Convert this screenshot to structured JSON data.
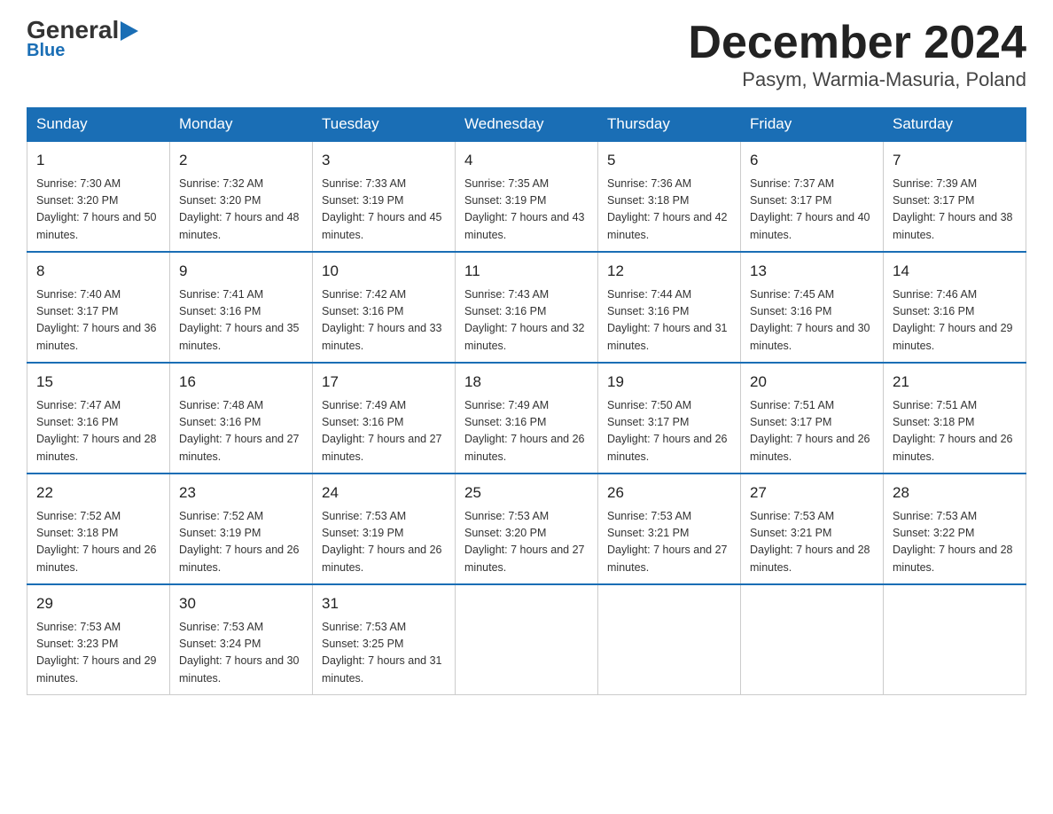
{
  "header": {
    "logo_main": "General",
    "logo_triangle": "▶",
    "logo_sub": "Blue",
    "title": "December 2024",
    "subtitle": "Pasym, Warmia-Masuria, Poland"
  },
  "weekdays": [
    "Sunday",
    "Monday",
    "Tuesday",
    "Wednesday",
    "Thursday",
    "Friday",
    "Saturday"
  ],
  "weeks": [
    [
      {
        "day": "1",
        "sunrise": "7:30 AM",
        "sunset": "3:20 PM",
        "daylight": "7 hours and 50 minutes."
      },
      {
        "day": "2",
        "sunrise": "7:32 AM",
        "sunset": "3:20 PM",
        "daylight": "7 hours and 48 minutes."
      },
      {
        "day": "3",
        "sunrise": "7:33 AM",
        "sunset": "3:19 PM",
        "daylight": "7 hours and 45 minutes."
      },
      {
        "day": "4",
        "sunrise": "7:35 AM",
        "sunset": "3:19 PM",
        "daylight": "7 hours and 43 minutes."
      },
      {
        "day": "5",
        "sunrise": "7:36 AM",
        "sunset": "3:18 PM",
        "daylight": "7 hours and 42 minutes."
      },
      {
        "day": "6",
        "sunrise": "7:37 AM",
        "sunset": "3:17 PM",
        "daylight": "7 hours and 40 minutes."
      },
      {
        "day": "7",
        "sunrise": "7:39 AM",
        "sunset": "3:17 PM",
        "daylight": "7 hours and 38 minutes."
      }
    ],
    [
      {
        "day": "8",
        "sunrise": "7:40 AM",
        "sunset": "3:17 PM",
        "daylight": "7 hours and 36 minutes."
      },
      {
        "day": "9",
        "sunrise": "7:41 AM",
        "sunset": "3:16 PM",
        "daylight": "7 hours and 35 minutes."
      },
      {
        "day": "10",
        "sunrise": "7:42 AM",
        "sunset": "3:16 PM",
        "daylight": "7 hours and 33 minutes."
      },
      {
        "day": "11",
        "sunrise": "7:43 AM",
        "sunset": "3:16 PM",
        "daylight": "7 hours and 32 minutes."
      },
      {
        "day": "12",
        "sunrise": "7:44 AM",
        "sunset": "3:16 PM",
        "daylight": "7 hours and 31 minutes."
      },
      {
        "day": "13",
        "sunrise": "7:45 AM",
        "sunset": "3:16 PM",
        "daylight": "7 hours and 30 minutes."
      },
      {
        "day": "14",
        "sunrise": "7:46 AM",
        "sunset": "3:16 PM",
        "daylight": "7 hours and 29 minutes."
      }
    ],
    [
      {
        "day": "15",
        "sunrise": "7:47 AM",
        "sunset": "3:16 PM",
        "daylight": "7 hours and 28 minutes."
      },
      {
        "day": "16",
        "sunrise": "7:48 AM",
        "sunset": "3:16 PM",
        "daylight": "7 hours and 27 minutes."
      },
      {
        "day": "17",
        "sunrise": "7:49 AM",
        "sunset": "3:16 PM",
        "daylight": "7 hours and 27 minutes."
      },
      {
        "day": "18",
        "sunrise": "7:49 AM",
        "sunset": "3:16 PM",
        "daylight": "7 hours and 26 minutes."
      },
      {
        "day": "19",
        "sunrise": "7:50 AM",
        "sunset": "3:17 PM",
        "daylight": "7 hours and 26 minutes."
      },
      {
        "day": "20",
        "sunrise": "7:51 AM",
        "sunset": "3:17 PM",
        "daylight": "7 hours and 26 minutes."
      },
      {
        "day": "21",
        "sunrise": "7:51 AM",
        "sunset": "3:18 PM",
        "daylight": "7 hours and 26 minutes."
      }
    ],
    [
      {
        "day": "22",
        "sunrise": "7:52 AM",
        "sunset": "3:18 PM",
        "daylight": "7 hours and 26 minutes."
      },
      {
        "day": "23",
        "sunrise": "7:52 AM",
        "sunset": "3:19 PM",
        "daylight": "7 hours and 26 minutes."
      },
      {
        "day": "24",
        "sunrise": "7:53 AM",
        "sunset": "3:19 PM",
        "daylight": "7 hours and 26 minutes."
      },
      {
        "day": "25",
        "sunrise": "7:53 AM",
        "sunset": "3:20 PM",
        "daylight": "7 hours and 27 minutes."
      },
      {
        "day": "26",
        "sunrise": "7:53 AM",
        "sunset": "3:21 PM",
        "daylight": "7 hours and 27 minutes."
      },
      {
        "day": "27",
        "sunrise": "7:53 AM",
        "sunset": "3:21 PM",
        "daylight": "7 hours and 28 minutes."
      },
      {
        "day": "28",
        "sunrise": "7:53 AM",
        "sunset": "3:22 PM",
        "daylight": "7 hours and 28 minutes."
      }
    ],
    [
      {
        "day": "29",
        "sunrise": "7:53 AM",
        "sunset": "3:23 PM",
        "daylight": "7 hours and 29 minutes."
      },
      {
        "day": "30",
        "sunrise": "7:53 AM",
        "sunset": "3:24 PM",
        "daylight": "7 hours and 30 minutes."
      },
      {
        "day": "31",
        "sunrise": "7:53 AM",
        "sunset": "3:25 PM",
        "daylight": "7 hours and 31 minutes."
      },
      null,
      null,
      null,
      null
    ]
  ]
}
